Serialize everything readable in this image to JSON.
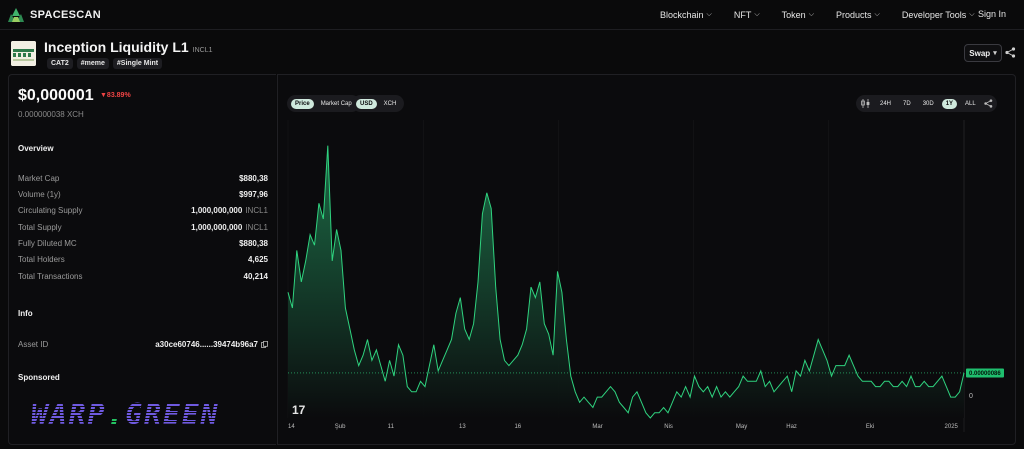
{
  "brand": {
    "name": "SPACESCAN"
  },
  "nav": {
    "items": [
      {
        "label": "Blockchain"
      },
      {
        "label": "NFT"
      },
      {
        "label": "Token"
      },
      {
        "label": "Products"
      },
      {
        "label": "Developer Tools"
      }
    ],
    "sign_in": "Sign In"
  },
  "token": {
    "name": "Inception Liquidity L1",
    "ticker": "INCL1",
    "tags": [
      "CAT2",
      "#meme",
      "#Single Mint"
    ],
    "swap_label": "Swap"
  },
  "stats": {
    "price": "$0,000001",
    "change": "▼83.89%",
    "xch_price": "0.000000038 XCH",
    "overview_title": "Overview",
    "rows": [
      {
        "label": "Market Cap",
        "value": "$880,38",
        "unit": ""
      },
      {
        "label": "Volume (1y)",
        "value": "$997,96",
        "unit": ""
      },
      {
        "label": "Circulating Supply",
        "value": "1,000,000,000",
        "unit": "INCL1"
      },
      {
        "label": "Total Supply",
        "value": "1,000,000,000",
        "unit": "INCL1"
      },
      {
        "label": "Fully Diluted MC",
        "value": "$880,38",
        "unit": ""
      },
      {
        "label": "Total Holders",
        "value": "4,625",
        "unit": ""
      },
      {
        "label": "Total Transactions",
        "value": "40,214",
        "unit": ""
      }
    ],
    "info_title": "Info",
    "asset_id_label": "Asset ID",
    "asset_id_value": "a30ce60746......39474b96a7",
    "sponsored_title": "Sponsored",
    "sponsor_text_a": "WARP",
    "sponsor_text_dot": ".",
    "sponsor_text_b": "GREEN"
  },
  "chart_controls": {
    "metric": [
      "Price",
      "Market Cap"
    ],
    "currency": [
      "USD",
      "XCH"
    ],
    "ranges": [
      "24H",
      "7D",
      "30D",
      "1Y",
      "ALL"
    ],
    "active_metric": "Price",
    "active_currency": "USD",
    "active_range": "1Y"
  },
  "chart_data": {
    "type": "area",
    "x_tick_labels": [
      "14",
      "Şub",
      "11",
      "13",
      "16",
      "Mar",
      "Nis",
      "May",
      "Haz",
      "Eki",
      "2025"
    ],
    "y_tick_labels": [
      "0"
    ],
    "current_value_label": "0.00000086",
    "watermark": "17",
    "colors": {
      "line": "#22c55e",
      "fill_top": "#1f7a4f",
      "fill_bottom": "#0b0b0d",
      "grid": "#1a1a1d"
    },
    "values": [
      2.4e-06,
      2.1e-06,
      3.2e-06,
      2.6e-06,
      3e-06,
      3.5e-06,
      3.3e-06,
      4.1e-06,
      3.8e-06,
      5.2e-06,
      3e-06,
      3.6e-06,
      3.2e-06,
      2.1e-06,
      1.7e-06,
      1.3e-06,
      1e-06,
      1.2e-06,
      1.5e-06,
      1.1e-06,
      1.3e-06,
      1e-06,
      7e-07,
      1.1e-06,
      8e-07,
      1.4e-06,
      1.2e-06,
      6e-07,
      5e-07,
      5e-07,
      7e-07,
      6e-07,
      1e-06,
      1.4e-06,
      9e-07,
      1.1e-06,
      1.3e-06,
      1.5e-06,
      2e-06,
      2.3e-06,
      1.7e-06,
      1.5e-06,
      1.8e-06,
      2.6e-06,
      3.9e-06,
      4.3e-06,
      4e-06,
      2.5e-06,
      1.5e-06,
      1.1e-06,
      1e-06,
      1.1e-06,
      1.2e-06,
      1.4e-06,
      1.7e-06,
      2.5e-06,
      2.3e-06,
      2.6e-06,
      1.8e-06,
      1.6e-06,
      1.2e-06,
      2.8e-06,
      2.4e-06,
      1.5e-06,
      8e-07,
      5e-07,
      3e-07,
      4e-07,
      3e-07,
      2e-07,
      4e-07,
      4e-07,
      5e-07,
      6e-07,
      5e-07,
      3e-07,
      2e-07,
      1e-07,
      4e-07,
      5e-07,
      3e-07,
      1e-07,
      0.0,
      1e-07,
      1e-07,
      2e-07,
      1e-07,
      3e-07,
      5e-07,
      4e-07,
      6e-07,
      4e-07,
      8e-07,
      6e-07,
      5e-07,
      6e-07,
      4e-07,
      6e-07,
      4e-07,
      5e-07,
      4e-07,
      5e-07,
      6e-07,
      8e-07,
      7e-07,
      7e-07,
      7e-07,
      9e-07,
      6e-07,
      7e-07,
      5e-07,
      6e-07,
      7e-07,
      8e-07,
      5e-07,
      9e-07,
      8e-07,
      1.1e-06,
      9e-07,
      1.2e-06,
      1.5e-06,
      1.3e-06,
      1.1e-06,
      8e-07,
      1e-06,
      1e-06,
      1e-06,
      1.2e-06,
      1e-06,
      8e-07,
      7e-07,
      7e-07,
      7e-07,
      6e-07,
      6e-07,
      7e-07,
      7e-07,
      6e-07,
      6e-07,
      7e-07,
      6e-07,
      8e-07,
      6e-07,
      6e-07,
      7e-07,
      6e-07,
      6e-07,
      7e-07,
      8e-07,
      6e-07,
      4e-07,
      4e-07,
      5e-07,
      8.6e-07
    ],
    "ylim": [
      0,
      5.5e-06
    ]
  }
}
